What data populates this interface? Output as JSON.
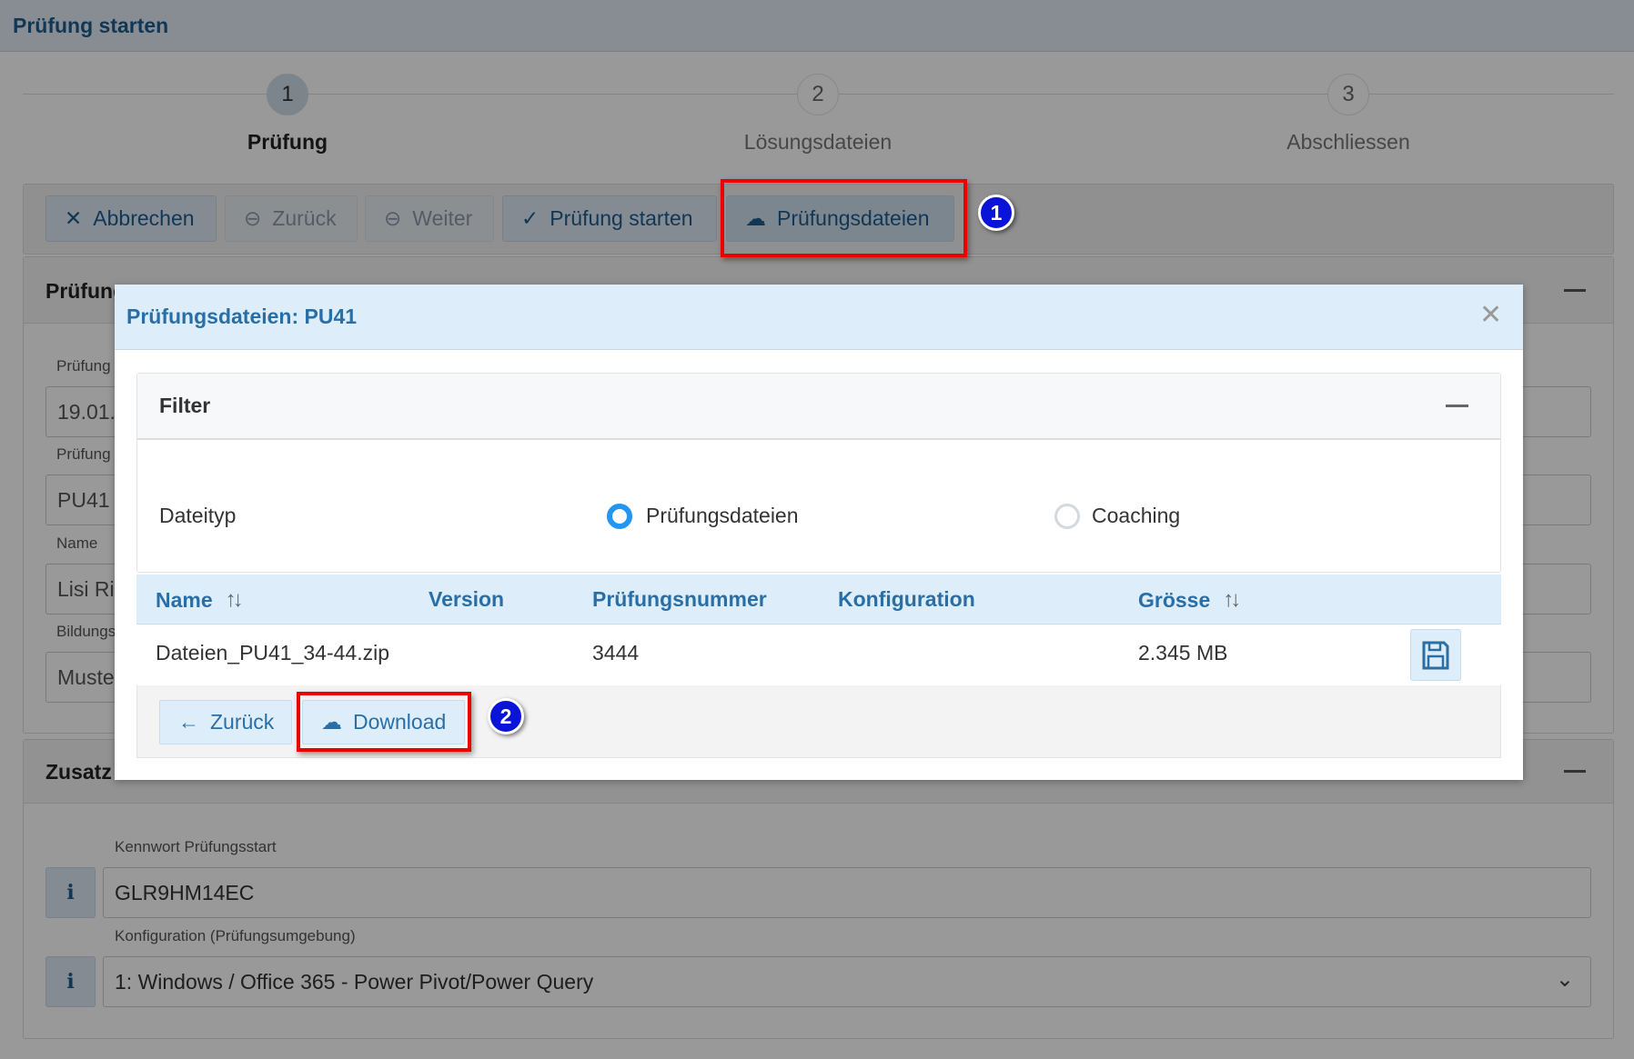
{
  "page": {
    "title": "Prüfung starten"
  },
  "stepper": [
    {
      "num": "1",
      "label": "Prüfung",
      "active": true
    },
    {
      "num": "2",
      "label": "Lösungsdateien"
    },
    {
      "num": "3",
      "label": "Abschliessen"
    }
  ],
  "toolbar": {
    "cancel": "Abbrechen",
    "back": "Zurück",
    "next": "Weiter",
    "start": "Prüfung starten",
    "files": "Prüfungsdateien"
  },
  "panel1": {
    "title": "Prüfung",
    "fields": [
      {
        "label": "Prüfung",
        "value": "19.01."
      },
      {
        "label": "Prüfung",
        "value": "PU41"
      },
      {
        "label": "Name",
        "value": "Lisi Ri"
      },
      {
        "label": "Bildungs",
        "value": "Muste"
      }
    ]
  },
  "panel2": {
    "title": "Zusatz",
    "password_label": "Kennwort Prüfungsstart",
    "password_value": "GLR9HM14EC",
    "config_label": "Konfiguration (Prüfungsumgebung)",
    "config_value": "1: Windows / Office 365 - Power Pivot/Power Query"
  },
  "annotations": {
    "badge1": "1",
    "badge2": "2"
  },
  "modal": {
    "title": "Prüfungsdateien: PU41",
    "filter": {
      "title": "Filter",
      "field_label": "Dateityp",
      "options": [
        {
          "label": "Prüfungsdateien",
          "selected": true
        },
        {
          "label": "Coaching",
          "selected": false
        }
      ]
    },
    "table": {
      "columns": [
        "Name",
        "Version",
        "Prüfungsnummer",
        "Konfiguration",
        "Grösse"
      ],
      "rows": [
        {
          "name": "Dateien_PU41_34-44.zip",
          "version": "",
          "number": "3444",
          "config": "",
          "size": "2.345 MB"
        }
      ]
    },
    "footer": {
      "back": "Zurück",
      "download": "Download"
    }
  },
  "colors": {
    "accent": "#2a6ea6",
    "radio": "#2196f3",
    "annotation_box": "#ee0000",
    "annotation_badge": "#0a14d8"
  }
}
